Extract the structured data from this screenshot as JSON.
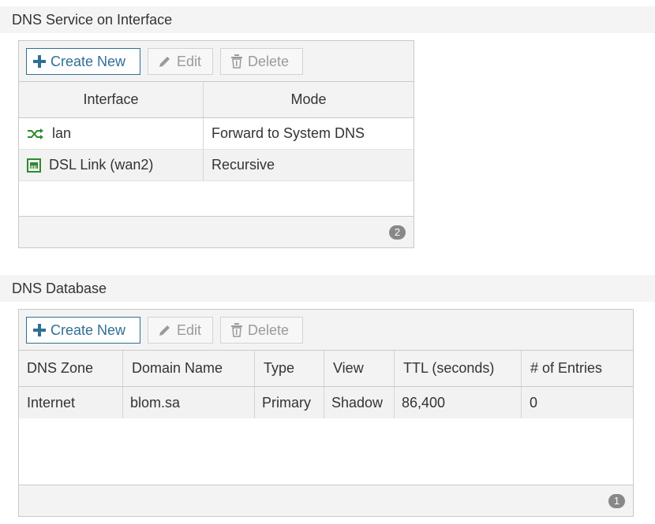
{
  "dns_service": {
    "title": "DNS Service on Interface",
    "toolbar": {
      "create_label": "Create New",
      "edit_label": "Edit",
      "delete_label": "Delete"
    },
    "columns": [
      "Interface",
      "Mode"
    ],
    "rows": [
      {
        "interface": "lan",
        "icon": "network-switch-icon",
        "mode": "Forward to System DNS"
      },
      {
        "interface": "DSL Link (wan2)",
        "icon": "dsl-port-icon",
        "mode": "Recursive"
      }
    ],
    "count": "2"
  },
  "dns_database": {
    "title": "DNS Database",
    "toolbar": {
      "create_label": "Create New",
      "edit_label": "Edit",
      "delete_label": "Delete"
    },
    "columns": [
      "DNS Zone",
      "Domain Name",
      "Type",
      "View",
      "TTL (seconds)",
      "# of Entries"
    ],
    "rows": [
      {
        "zone": "Internet",
        "domain": "blom.sa",
        "type": "Primary",
        "view": "Shadow",
        "ttl": "86,400",
        "entries": "0"
      }
    ],
    "count": "1"
  },
  "colors": {
    "accent": "#2f6f95",
    "icon_green": "#2e8b2e"
  }
}
